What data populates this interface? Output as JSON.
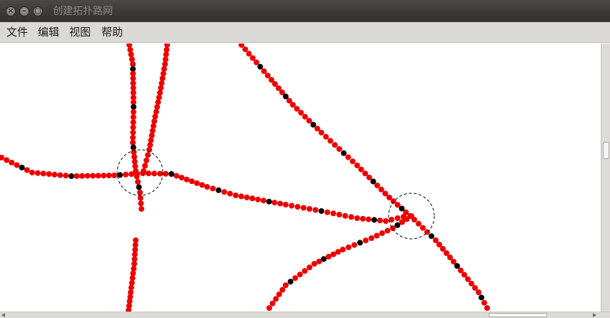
{
  "window": {
    "title": "创建拓扑路网",
    "controls": {
      "close_icon": "close-icon",
      "minimize_icon": "minimize-icon",
      "maximize_icon": "maximize-icon"
    }
  },
  "menubar": {
    "items": [
      {
        "label": "文件"
      },
      {
        "label": "编辑"
      },
      {
        "label": "视图"
      },
      {
        "label": "帮助"
      }
    ]
  },
  "canvas": {
    "colors": {
      "point": "#ee0000",
      "node_point": "#000000",
      "circle": "#000000",
      "background": "#ffffff"
    }
  }
}
